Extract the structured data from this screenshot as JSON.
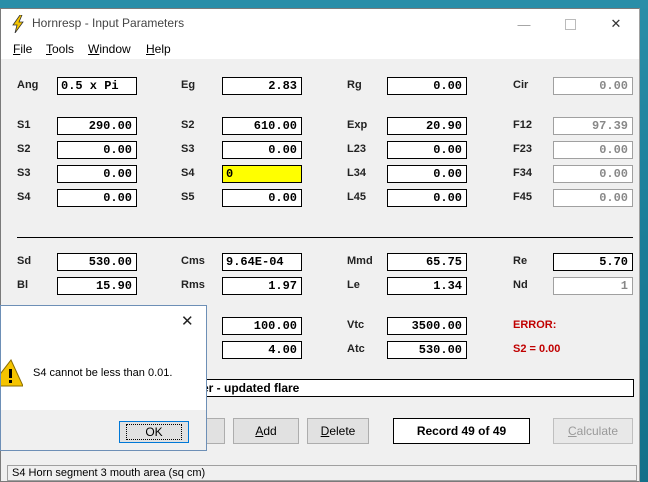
{
  "window": {
    "title": "Hornresp - Input Parameters",
    "menu": [
      "File",
      "Tools",
      "Window",
      "Help"
    ]
  },
  "params": {
    "ang_label": "Ang",
    "ang": "0.5 x Pi",
    "eg_label": "Eg",
    "eg": "2.83",
    "rg_label": "Rg",
    "rg": "0.00",
    "cir_label": "Cir",
    "cir": "0.00",
    "s1_label": "S1",
    "s1": "290.00",
    "s2_label": "S2",
    "s2": "610.00",
    "exp_label": "Exp",
    "exp": "20.90",
    "f12_label": "F12",
    "f12": "97.39",
    "s2b_label": "S2",
    "s2b": "0.00",
    "s3_label": "S3",
    "s3": "0.00",
    "l23_label": "L23",
    "l23": "0.00",
    "f23_label": "F23",
    "f23": "0.00",
    "s3b_label": "S3",
    "s3b": "0.00",
    "s4_label": "S4",
    "s4": "0",
    "l34_label": "L34",
    "l34": "0.00",
    "f34_label": "F34",
    "f34": "0.00",
    "s4b_label": "S4",
    "s4b": "0.00",
    "s5_label": "S5",
    "s5": "0.00",
    "l45_label": "L45",
    "l45": "0.00",
    "f45_label": "F45",
    "f45": "0.00",
    "sd_label": "Sd",
    "sd": "530.00",
    "cms_label": "Cms",
    "cms": "9.64E-04",
    "mmd_label": "Mmd",
    "mmd": "65.75",
    "re_label": "Re",
    "re": "5.70",
    "bl_label": "Bl",
    "bl": "15.90",
    "rms_label": "Rms",
    "rms": "1.97",
    "le_label": "Le",
    "le": "1.34",
    "nd_label": "Nd",
    "nd": "1",
    "hidden1": "100.00",
    "vtc_label": "Vtc",
    "vtc": "3500.00",
    "hidden2": "4.00",
    "atc_label": "Atc",
    "atc": "530.00"
  },
  "errors": {
    "title": "ERROR:",
    "detail": "S2 = 0.00"
  },
  "comment": "er - updated flare",
  "buttons": {
    "add": "Add",
    "delete": "Delete",
    "calculate": "Calculate"
  },
  "record": "Record 49 of 49",
  "status": "S4   Horn segment 3 mouth area  (sq cm)",
  "dialog": {
    "message": "S4 cannot be less than 0.01.",
    "ok": "OK"
  },
  "colors": {
    "error": "#c00000",
    "highlight": "#ffff00"
  }
}
